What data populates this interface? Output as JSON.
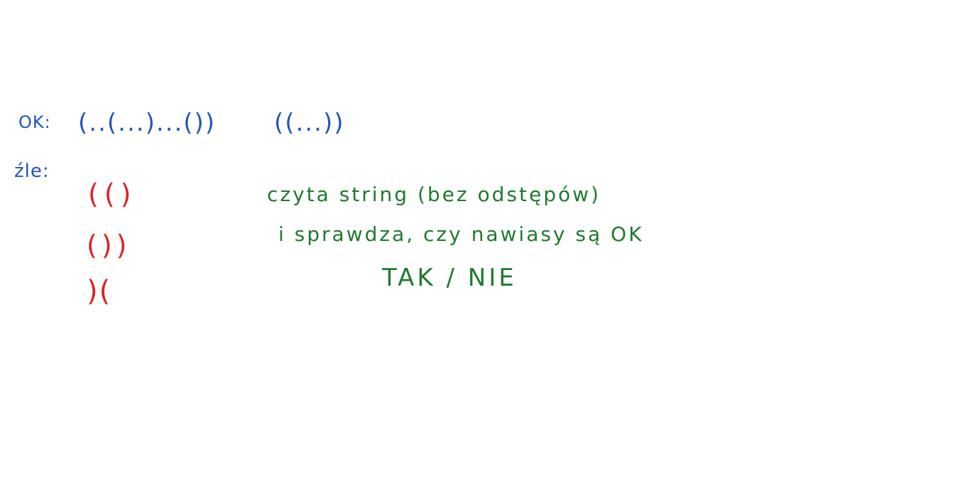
{
  "colors": {
    "ok_ink": "#2255bb",
    "bad_ink": "#dd2222",
    "task_ink": "#1f7a2e",
    "background": "#ffffff"
  },
  "ok": {
    "label": "OK:",
    "examples": [
      "(..(...)...())",
      "((...))"
    ]
  },
  "bad": {
    "label": "źle:",
    "examples": [
      "(()",
      "())",
      ")("
    ]
  },
  "task": {
    "lines": [
      "czyta string (bez odstępów)",
      "i sprawdza, czy nawiasy są OK",
      "TAK / NIE"
    ]
  }
}
